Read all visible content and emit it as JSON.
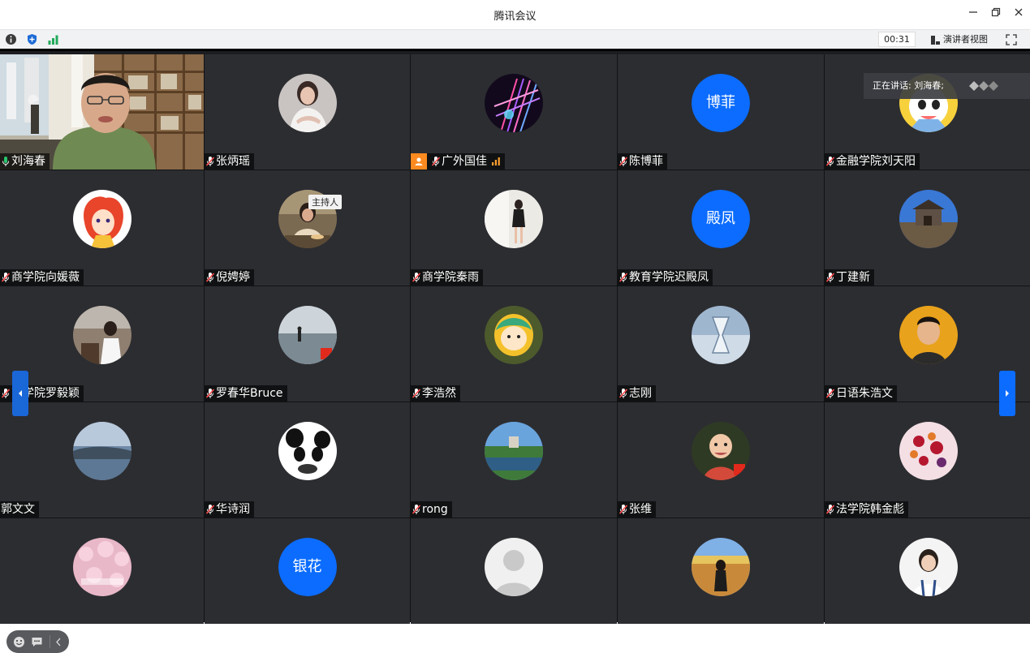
{
  "window": {
    "title": "腾讯会议"
  },
  "toolbar": {
    "timer": "00:31",
    "speaker_view_label": "演讲者视图"
  },
  "speaking": {
    "label": "正在讲话: 刘海春;"
  },
  "host_badge": "主持人",
  "participants": [
    {
      "name": "刘海春",
      "mic": "on",
      "kind": "video"
    },
    {
      "name": "张炳瑶",
      "mic": "off",
      "kind": "photo"
    },
    {
      "name": "广外国佳",
      "mic": "off",
      "kind": "photo"
    },
    {
      "name": "陈博菲",
      "mic": "off",
      "kind": "text",
      "avatar_text": "博菲"
    },
    {
      "name": "金融学院刘天阳",
      "mic": "off",
      "kind": "photo"
    },
    {
      "name": "商学院向媛薇",
      "mic": "off",
      "kind": "photo"
    },
    {
      "name": "倪娉婷",
      "mic": "off",
      "kind": "photo"
    },
    {
      "name": "商学院秦雨",
      "mic": "off",
      "kind": "photo"
    },
    {
      "name": "教育学院迟殿凤",
      "mic": "off",
      "kind": "text",
      "avatar_text": "殿凤"
    },
    {
      "name": "丁建新",
      "mic": "off",
      "kind": "photo"
    },
    {
      "name": "商学院罗毅颖",
      "mic": "off",
      "kind": "photo"
    },
    {
      "name": "罗春华Bruce",
      "mic": "off",
      "kind": "photo"
    },
    {
      "name": "李浩然",
      "mic": "off",
      "kind": "photo"
    },
    {
      "name": "志刚",
      "mic": "off",
      "kind": "photo"
    },
    {
      "name": "日语朱浩文",
      "mic": "off",
      "kind": "photo"
    },
    {
      "name": "郭文文",
      "mic": "none",
      "kind": "photo"
    },
    {
      "name": "华诗润",
      "mic": "off",
      "kind": "photo"
    },
    {
      "name": "rong",
      "mic": "off",
      "kind": "photo"
    },
    {
      "name": "张维",
      "mic": "off",
      "kind": "photo"
    },
    {
      "name": "法学院韩金彪",
      "mic": "off",
      "kind": "photo"
    },
    {
      "name": "",
      "mic": "none",
      "kind": "photo"
    },
    {
      "name": "",
      "mic": "none",
      "kind": "text",
      "avatar_text": "银花"
    },
    {
      "name": "",
      "mic": "none",
      "kind": "placeholder"
    },
    {
      "name": "",
      "mic": "none",
      "kind": "photo"
    },
    {
      "name": "",
      "mic": "none",
      "kind": "photo"
    }
  ],
  "colors": {
    "accent": "#0b6cff",
    "tile_bg": "#2c2d31",
    "active_speaker_border": "#27c46b",
    "mic_muted": "#ff4d4f"
  }
}
